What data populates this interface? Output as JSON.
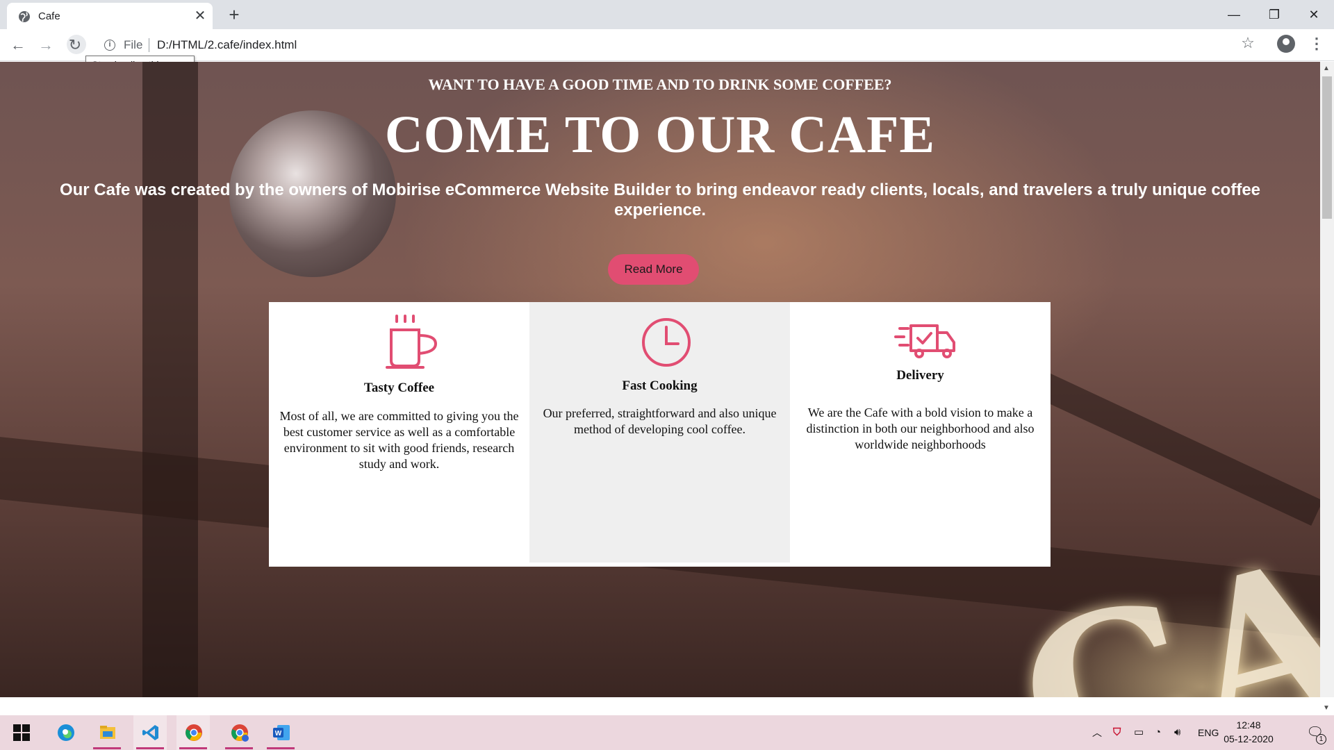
{
  "browser": {
    "tab_title": "Cafe",
    "tab_close": "✕",
    "new_tab": "+",
    "address_scheme": "File",
    "url": "D:/HTML/2.cafe/index.html",
    "tooltip": "Stop loading this page",
    "window_controls": {
      "minimize": "—",
      "maximize": "❐",
      "close": "✕"
    }
  },
  "hero": {
    "pre_title": "WANT TO HAVE A GOOD TIME AND TO DRINK SOME COFFEE?",
    "title": "COME TO OUR CAFE",
    "lead": "Our Cafe was created by the owners of Mobirise eCommerce Website Builder to bring endeavor ready clients, locals, and travelers a truly unique coffee experience.",
    "cta_label": "Read More",
    "accent_color": "#e14d72",
    "sign_text": "CAF"
  },
  "features": [
    {
      "icon": "coffee-cup-icon",
      "title": "Tasty Coffee",
      "text": "Most of all, we are committed to giving you the best customer service as well as a comfortable environment to sit with good friends, research study and work."
    },
    {
      "icon": "clock-icon",
      "title": "Fast Cooking",
      "text": "Our preferred, straightforward and also unique method of developing cool coffee."
    },
    {
      "icon": "delivery-truck-icon",
      "title": "Delivery",
      "text": "We are the Cafe with a bold vision to make a distinction in both our neighborhood and also worldwide neighborhoods"
    }
  ],
  "taskbar": {
    "apps": [
      "windows-start-icon",
      "edge-icon",
      "file-explorer-icon",
      "vscode-icon",
      "chrome-icon",
      "chrome-profile-icon",
      "word-icon"
    ],
    "language": "ENG",
    "time": "12:48",
    "date": "05-12-2020",
    "notifications_count": "1"
  }
}
